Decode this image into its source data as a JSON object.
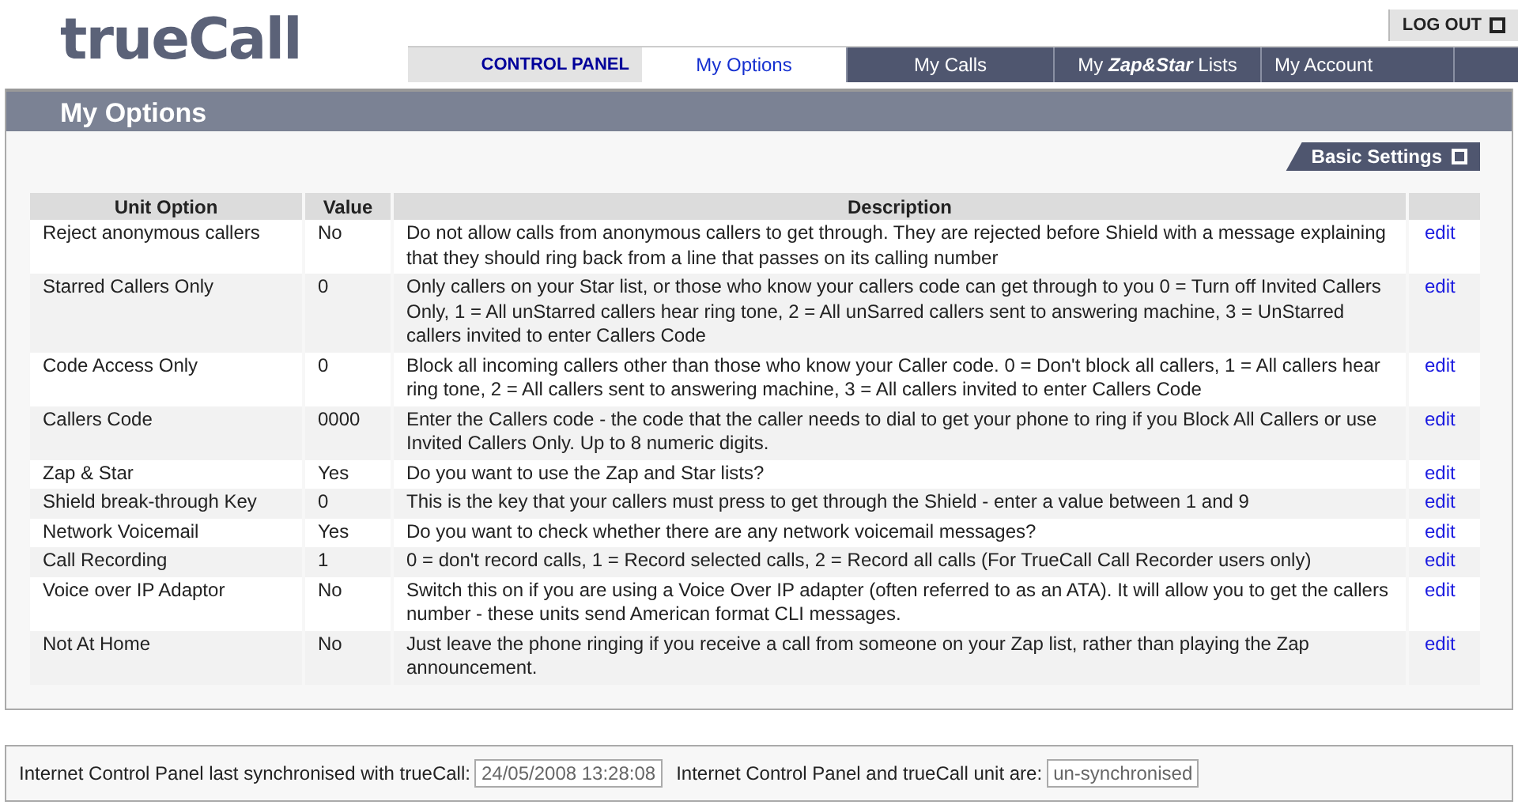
{
  "logo": "trueCall",
  "logout": "LOG OUT",
  "control_panel": "CONTROL PANEL",
  "tabs": [
    {
      "label": "My Options",
      "selected": true
    },
    {
      "label": "My Calls",
      "selected": false
    },
    {
      "label": "My **Zap&Star** Lists",
      "selected": false
    },
    {
      "label": "My Account",
      "selected": false
    }
  ],
  "page_title": "My Options",
  "basic_settings": "Basic Settings",
  "table": {
    "columns": [
      "Unit Option",
      "Value",
      "Description"
    ],
    "rows": [
      {
        "option": "Reject anonymous callers",
        "value": "No",
        "description": "Do not allow calls from anonymous callers to get through. They are rejected before Shield with a message explaining that they should ring back from a line that passes on its calling number",
        "action": "edit"
      },
      {
        "option": "Starred Callers Only",
        "value": "0",
        "description": "Only callers on your Star list, or those who know your callers code can get through to you 0 = Turn off Invited Callers Only, 1 = All unStarred callers hear ring tone, 2 = All unSarred callers sent to answering machine, 3 = UnStarred callers invited to enter Callers Code",
        "action": "edit"
      },
      {
        "option": "Code Access Only",
        "value": "0",
        "description": "Block all incoming callers other than those who know your Caller code. 0 = Don't block all callers, 1 = All callers hear ring tone, 2 = All callers sent to answering machine, 3 = All callers invited to enter Callers Code",
        "action": "edit"
      },
      {
        "option": "Callers Code",
        "value": "0000",
        "description": "Enter the Callers code - the code that the caller needs to dial to get your phone to ring if you Block All Callers or use Invited Callers Only. Up to 8 numeric digits.",
        "action": "edit"
      },
      {
        "option": "Zap & Star",
        "value": "Yes",
        "description": "Do you want to use the Zap and Star lists?",
        "action": "edit"
      },
      {
        "option": "Shield break-through Key",
        "value": "0",
        "description": "This is the key that your callers must press to get through the Shield - enter a value between 1 and 9",
        "action": "edit"
      },
      {
        "option": "Network Voicemail",
        "value": "Yes",
        "description": "Do you want to check whether there are any network voicemail messages?",
        "action": "edit"
      },
      {
        "option": "Call Recording",
        "value": "1",
        "description": "0 = don't record calls, 1 = Record selected calls, 2 = Record all calls (For TrueCall Call Recorder users only)",
        "action": "edit"
      },
      {
        "option": "Voice over IP Adaptor",
        "value": "No",
        "description": "Switch this on if you are using a Voice Over IP adapter (often referred to as an ATA). It will allow you to get the callers number - these units send American format CLI messages.",
        "action": "edit"
      },
      {
        "option": "Not At Home",
        "value": "No",
        "description": "Just leave the phone ringing if you receive a call from someone on your Zap list, rather than playing the Zap announcement.",
        "action": "edit"
      }
    ]
  },
  "status_bar": {
    "sync_label": "Internet Control Panel last synchronised with trueCall:",
    "sync_value": "24/05/2008 13:28:08",
    "state_label": "Internet Control Panel and trueCall unit are:",
    "state_value": "un-synchronised"
  }
}
